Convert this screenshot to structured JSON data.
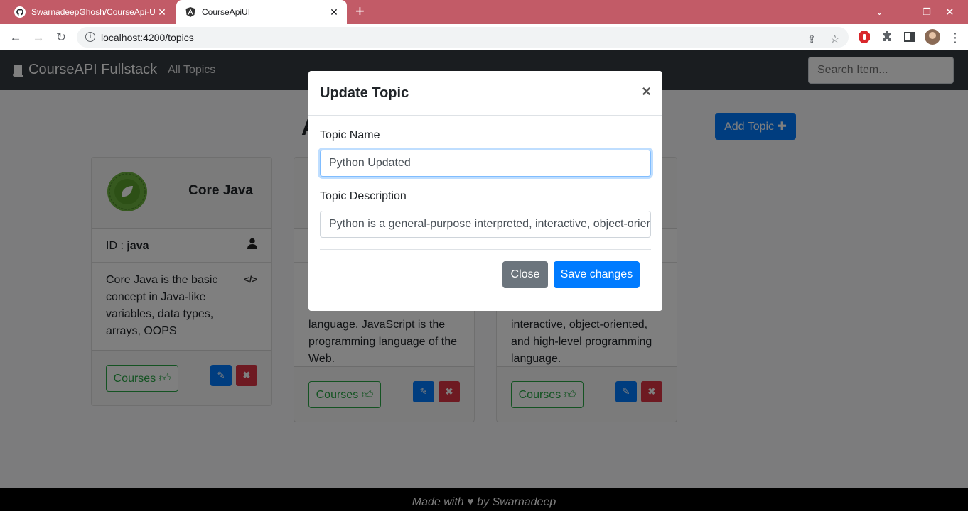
{
  "browser": {
    "tabs": [
      {
        "title": "SwarnadeepGhosh/CourseApi-UI",
        "icon": "github-icon"
      },
      {
        "title": "CourseApiUI",
        "icon": "angular-icon"
      }
    ],
    "url": "localhost:4200/topics",
    "colors": {
      "tabbar": "#c25b67"
    }
  },
  "app": {
    "brand": "CourseAPI Fullstack",
    "nav_link": "All Topics",
    "search_placeholder": "Search Item...",
    "heading_visible_char": "A",
    "add_topic_label": "Add Topic ✚",
    "cards": [
      {
        "name": "Core Java",
        "id_label": "ID :",
        "id_value": "java",
        "description": "Core Java is the basic concept in Java-like variables, data types, arrays, OOPS",
        "courses_label": "Courses"
      },
      {
        "description": "language. JavaScript is the programming language of the Web.",
        "courses_label": "Courses"
      },
      {
        "description": "interactive, object-oriented, and high-level programming language.",
        "courses_label": "Courses"
      }
    ],
    "footer": {
      "prefix": "Made with",
      "suffix": "by Swarnadeep"
    }
  },
  "modal": {
    "title": "Update Topic",
    "name_label": "Topic Name",
    "name_value": "Python Updated",
    "desc_label": "Topic Description",
    "desc_value": "Python is a general-purpose interpreted, interactive, object-oriented",
    "close_label": "Close",
    "save_label": "Save changes"
  }
}
